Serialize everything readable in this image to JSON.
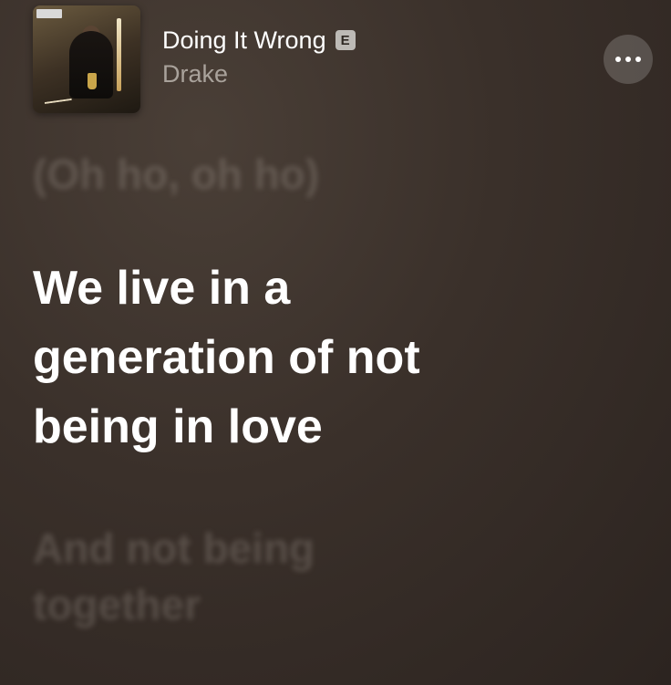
{
  "now_playing": {
    "title": "Doing It Wrong",
    "explicit_badge": "E",
    "artist": "Drake",
    "artwork_icon": "album-artwork",
    "more_icon": "ellipsis-icon"
  },
  "lyrics": {
    "previous": "(Oh ho, oh ho)",
    "current_lines": [
      "We live in a",
      "generation of not",
      "being in love"
    ],
    "next_lines": [
      "And not being",
      "together"
    ]
  },
  "colors": {
    "background": "#3a302a",
    "active_lyric": "#ffffff",
    "inactive_lyric": "#6b625b",
    "artist_text": "#a9a29b",
    "explicit_badge_bg": "#bdbab6"
  }
}
